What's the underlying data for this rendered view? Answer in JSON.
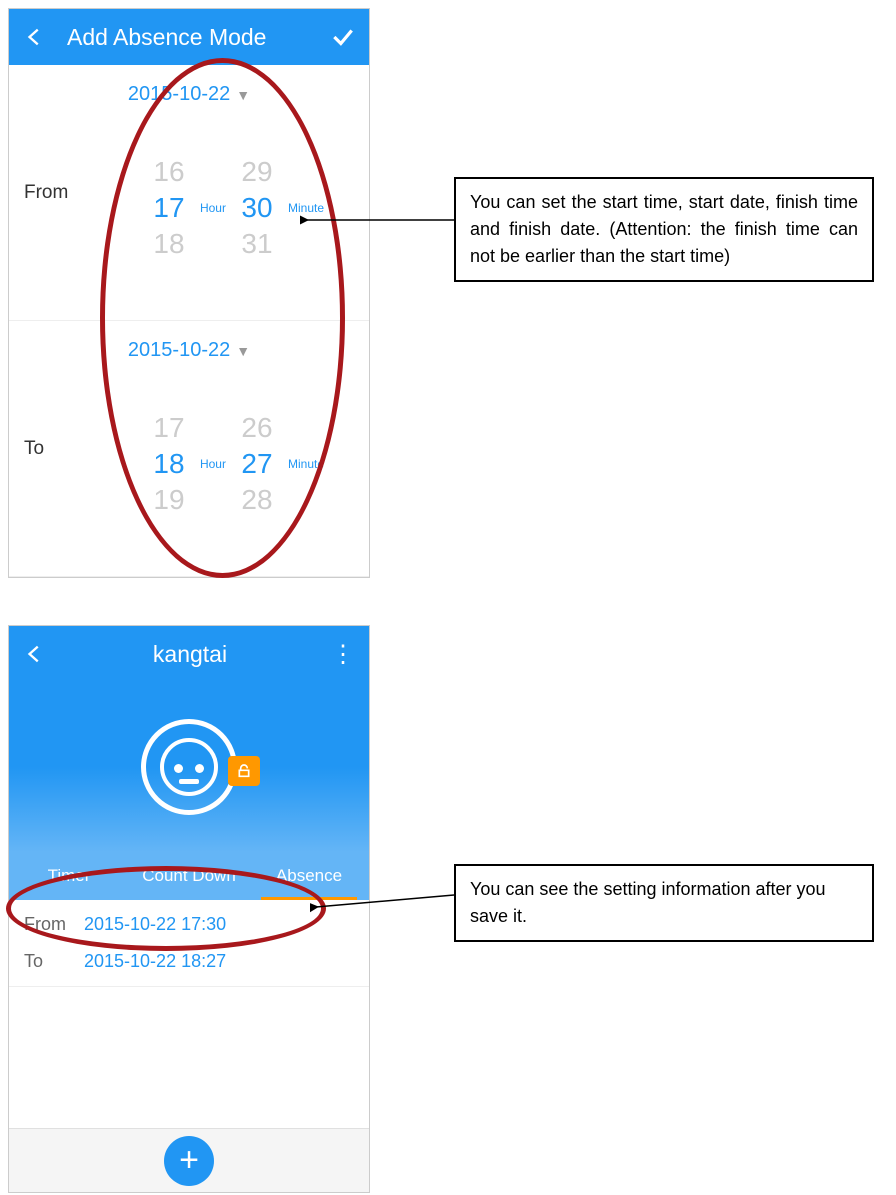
{
  "screen1": {
    "title": "Add Absence Mode",
    "from": {
      "label": "From",
      "date": "2015-10-22",
      "hour_prev": "16",
      "hour": "17",
      "hour_next": "18",
      "min_prev": "29",
      "min": "30",
      "min_next": "31",
      "hour_unit": "Hour",
      "min_unit": "Minute"
    },
    "to": {
      "label": "To",
      "date": "2015-10-22",
      "hour_prev": "17",
      "hour": "18",
      "hour_next": "19",
      "min_prev": "26",
      "min": "27",
      "min_next": "28",
      "hour_unit": "Hour",
      "min_unit": "Minute"
    }
  },
  "screen2": {
    "title": "kangtai",
    "tabs": {
      "timer": "Timer",
      "countdown": "Count Down",
      "absence": "Absence"
    },
    "info": {
      "from_label": "From",
      "from_value": "2015-10-22 17:30",
      "to_label": "To",
      "to_value": "2015-10-22 18:27"
    }
  },
  "callouts": {
    "c1": "You can set the start time, start date, finish time and finish date. (Attention: the finish time can not be earlier than the start time)",
    "c2": "You can see the setting information after you save it."
  }
}
